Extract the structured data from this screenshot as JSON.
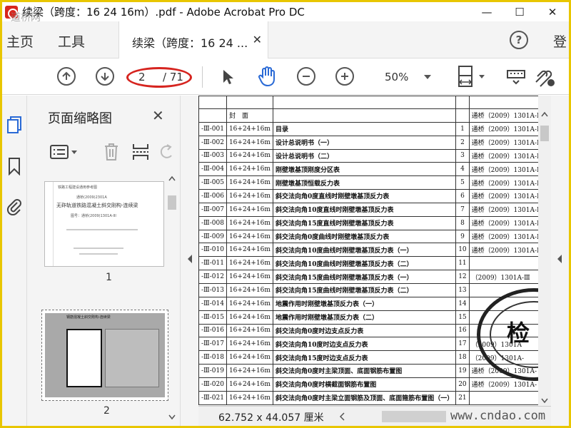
{
  "window": {
    "title": "续梁（跨度：16 24 16m）.pdf - Adobe Acrobat Pro DC",
    "minimize": "—",
    "maximize": "☐",
    "close": "✕"
  },
  "menu": {
    "home": "主页",
    "tools": "工具",
    "doc_tab": "续梁（跨度：16 24 ...",
    "doc_tab_close": "✕",
    "help": "?",
    "login": "登"
  },
  "toolbar": {
    "current_page": "2",
    "total_pages": "/ 71",
    "zoom": "50%",
    "icons": [
      "prev-page-icon",
      "next-page-icon",
      "select-cursor-icon",
      "hand-icon",
      "zoom-out-icon",
      "zoom-in-icon",
      "zoom-dropdown-icon",
      "page-fit-icon",
      "keyboard-icon",
      "sign-icon"
    ]
  },
  "thumbnails": {
    "title": "页面缩略图",
    "close": "✕",
    "pages": [
      {
        "label": "1",
        "lines": [
          "铁路工程建设通用参考图",
          "通桥(2009)2301A",
          "无砟轨道铁路混凝土斜交刚构-连续梁",
          "图号：通桥(2009)1301A-III"
        ]
      },
      {
        "label": "2",
        "header": "钢筋混凝土斜交刚构-连续梁"
      }
    ]
  },
  "doc": {
    "header_row": {
      "col2": "封　面",
      "ref": "通桥（2009）1301A-Ⅲ"
    },
    "rows": [
      {
        "code": "-Ⅲ-001",
        "name": "16+24+16m",
        "title": "目录",
        "page": "1",
        "ref": "通桥（2009）1301A-Ⅲ"
      },
      {
        "code": "-Ⅲ-002",
        "name": "16+24+16m",
        "title": "设计总说明书（一）",
        "page": "2",
        "ref": "通桥（2009）1301A-Ⅲ"
      },
      {
        "code": "-Ⅲ-003",
        "name": "16+24+16m",
        "title": "设计总说明书（二）",
        "page": "3",
        "ref": "通桥（2009）1301A-Ⅲ"
      },
      {
        "code": "-Ⅲ-004",
        "name": "16+24+16m",
        "title": "刚壁墩基顶刚度分区表",
        "page": "4",
        "ref": "通桥（2009）1301A-Ⅲ"
      },
      {
        "code": "-Ⅲ-005",
        "name": "16+24+16m",
        "title": "刚壁墩基顶恒载反力表",
        "page": "5",
        "ref": "通桥（2009）1301A-Ⅲ"
      },
      {
        "code": "-Ⅲ-006",
        "name": "16+24+16m",
        "title": "斜交法向角0度直线时刚壁墩基顶反力表",
        "page": "6",
        "ref": "通桥（2009）1301A-Ⅲ"
      },
      {
        "code": "-Ⅲ-007",
        "name": "16+24+16m",
        "title": "斜交法向角10度直线时刚壁墩基顶反力表",
        "page": "7",
        "ref": "通桥（2009）1301A-Ⅲ"
      },
      {
        "code": "-Ⅲ-008",
        "name": "16+24+16m",
        "title": "斜交法向角15度直线时刚壁墩基顶反力表",
        "page": "8",
        "ref": "通桥（2009）1301A-Ⅲ"
      },
      {
        "code": "-Ⅲ-009",
        "name": "16+24+16m",
        "title": "斜交法向角0度曲线时刚壁墩基顶反力表",
        "page": "9",
        "ref": "通桥（2009）1301A-Ⅲ"
      },
      {
        "code": "-Ⅲ-010",
        "name": "16+24+16m",
        "title": "斜交法向角10度曲线时刚壁墩基顶反力表（一）",
        "page": "10",
        "ref": "通桥（2009）1301A-Ⅲ"
      },
      {
        "code": "-Ⅲ-011",
        "name": "16+24+16m",
        "title": "斜交法向角10度曲线时刚壁墩基顶反力表（二）",
        "page": "11",
        "ref": ""
      },
      {
        "code": "-Ⅲ-012",
        "name": "16+24+16m",
        "title": "斜交法向角15度曲线时刚壁墩基顶反力表（一）",
        "page": "12",
        "ref": "（2009）1301A-Ⅲ"
      },
      {
        "code": "-Ⅲ-013",
        "name": "16+24+16m",
        "title": "斜交法向角15度曲线时刚壁墩基顶反力表（二）",
        "page": "13",
        "ref": ""
      },
      {
        "code": "-Ⅲ-014",
        "name": "16+24+16m",
        "title": "地震作用时刚壁墩基顶反力表（一）",
        "page": "14",
        "ref": ""
      },
      {
        "code": "-Ⅲ-015",
        "name": "16+24+16m",
        "title": "地震作用时刚壁墩基顶反力表（二）",
        "page": "15",
        "ref": ""
      },
      {
        "code": "-Ⅲ-016",
        "name": "16+24+16m",
        "title": "斜交法向角0度时边支点反力表",
        "page": "16",
        "ref": ""
      },
      {
        "code": "-Ⅲ-017",
        "name": "16+24+16m",
        "title": "斜交法向角10度时边支点反力表",
        "page": "17",
        "ref": "（2009）1301A"
      },
      {
        "code": "-Ⅲ-018",
        "name": "16+24+16m",
        "title": "斜交法向角15度时边支点反力表",
        "page": "18",
        "ref": "（2009）1301A-"
      },
      {
        "code": "-Ⅲ-019",
        "name": "16+24+16m",
        "title": "斜交法向角0度时主梁顶面、底面钢筋布置图",
        "page": "19",
        "ref": "通桥（2009）1301A-"
      },
      {
        "code": "-Ⅲ-020",
        "name": "16+24+16m",
        "title": "斜交法向角0度时横截面钢筋布置图",
        "page": "20",
        "ref": "通桥（2009）1301A-"
      },
      {
        "code": "-Ⅲ-021",
        "name": "16+24+16m",
        "title": "斜交法向角0度时主梁立面钢筋及顶面、底面箍筋布置图（一）",
        "page": "21",
        "ref": ""
      }
    ],
    "stamp": "检"
  },
  "status": {
    "page_size": "62.752 x 44.057 厘米"
  },
  "watermarks": {
    "bottom_right": "www.cndao.com",
    "top_left": "道桥网"
  },
  "colors": {
    "frame": "#e8c600",
    "annotation_red": "#d6241f",
    "icon_blue": "#2a6ad6"
  }
}
